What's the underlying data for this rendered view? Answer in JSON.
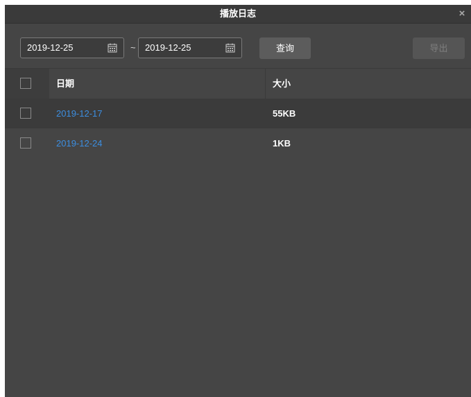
{
  "dialog": {
    "title": "播放日志",
    "close_glyph": "×",
    "close_icon": "close-icon"
  },
  "filter": {
    "start_date": "2019-12-25",
    "end_date": "2019-12-25",
    "separator": "~",
    "calendar_icon": "calendar-icon",
    "query_label": "查询",
    "export_label": "导出"
  },
  "table": {
    "columns": [
      "日期",
      "大小"
    ],
    "rows": [
      {
        "date": "2019-12-17",
        "size": "55KB"
      },
      {
        "date": "2019-12-24",
        "size": "1KB"
      }
    ]
  },
  "colors": {
    "background": "#454545",
    "link": "#3c8ee0"
  }
}
